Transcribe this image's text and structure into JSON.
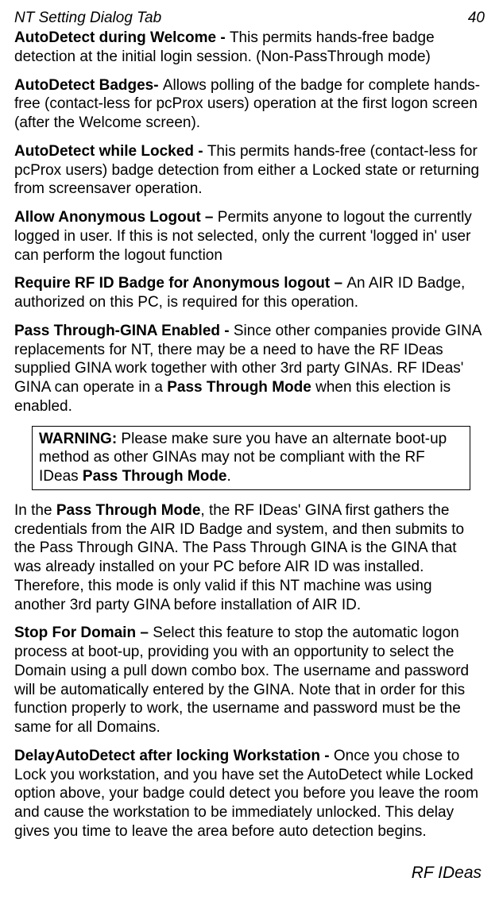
{
  "header": {
    "section": "NT Setting Dialog Tab",
    "page_number": "40"
  },
  "paragraphs": {
    "p1_bold": "AutoDetect during Welcome - ",
    "p1_rest": "This permits hands-free badge detection at the initial login session. (Non-PassThrough mode)",
    "p2_bold": "AutoDetect Badges- ",
    "p2_rest": "Allows polling of the badge for complete hands-free (contact-less for pcProx users) operation at the first logon screen (after the Welcome screen).",
    "p3_bold": "AutoDetect while Locked - ",
    "p3_rest": "This permits hands-free (contact-less for pcProx users) badge detection from either a Locked state or returning from screensaver operation.",
    "p4_bold": "Allow Anonymous Logout – ",
    "p4_rest": "Permits anyone to logout the currently logged in user.  If this is not selected, only the current 'logged in' user can perform the logout function",
    "p5_bold": "Require RF ID Badge for Anonymous logout – ",
    "p5_rest": "An AIR ID Badge, authorized on this PC, is required for this operation.",
    "p6_bold": "Pass Through-GINA Enabled - ",
    "p6_mid": "Since other companies provide GINA replacements for NT, there may be a need to have the RF IDeas supplied GINA work together with other 3rd party GINAs. RF IDeas' GINA can operate in a ",
    "p6_mid_bold": "Pass Through Mode",
    "p6_end": " when this election is enabled.",
    "warn_bold1": "WARNING:",
    "warn_mid": " Please make sure you have an alternate boot-up method as other GINAs may not be compliant with the RF IDeas ",
    "warn_bold2": "Pass Through Mode",
    "warn_end": ".",
    "p7_pre": "In the ",
    "p7_bold": "Pass Through Mode",
    "p7_rest": ", the RF IDeas' GINA first gathers the credentials from the AIR ID Badge and system, and then submits to the Pass Through GINA.  The Pass Through GINA is the GINA that was already installed on your PC before AIR ID was installed. Therefore, this mode is only valid if this NT machine was using another 3rd party GINA before installation of AIR ID.",
    "p8_bold": "Stop For Domain – ",
    "p8_rest": "Select this feature to stop the automatic logon process at boot-up, providing you with an opportunity to select the Domain using a pull down combo box. The username and password will be automatically entered by the GINA. Note that in order for this function properly to work, the username and password must be the same for all Domains.",
    "p9_bold": "DelayAutoDetect after locking Workstation - ",
    "p9_rest": "Once you chose to Lock you workstation, and you have set the AutoDetect while Locked option above, your badge could detect you before you leave the room and cause the workstation to be immediately unlocked.  This delay gives you time to leave the area before auto detection begins."
  },
  "footer": {
    "text": "RF IDeas"
  }
}
